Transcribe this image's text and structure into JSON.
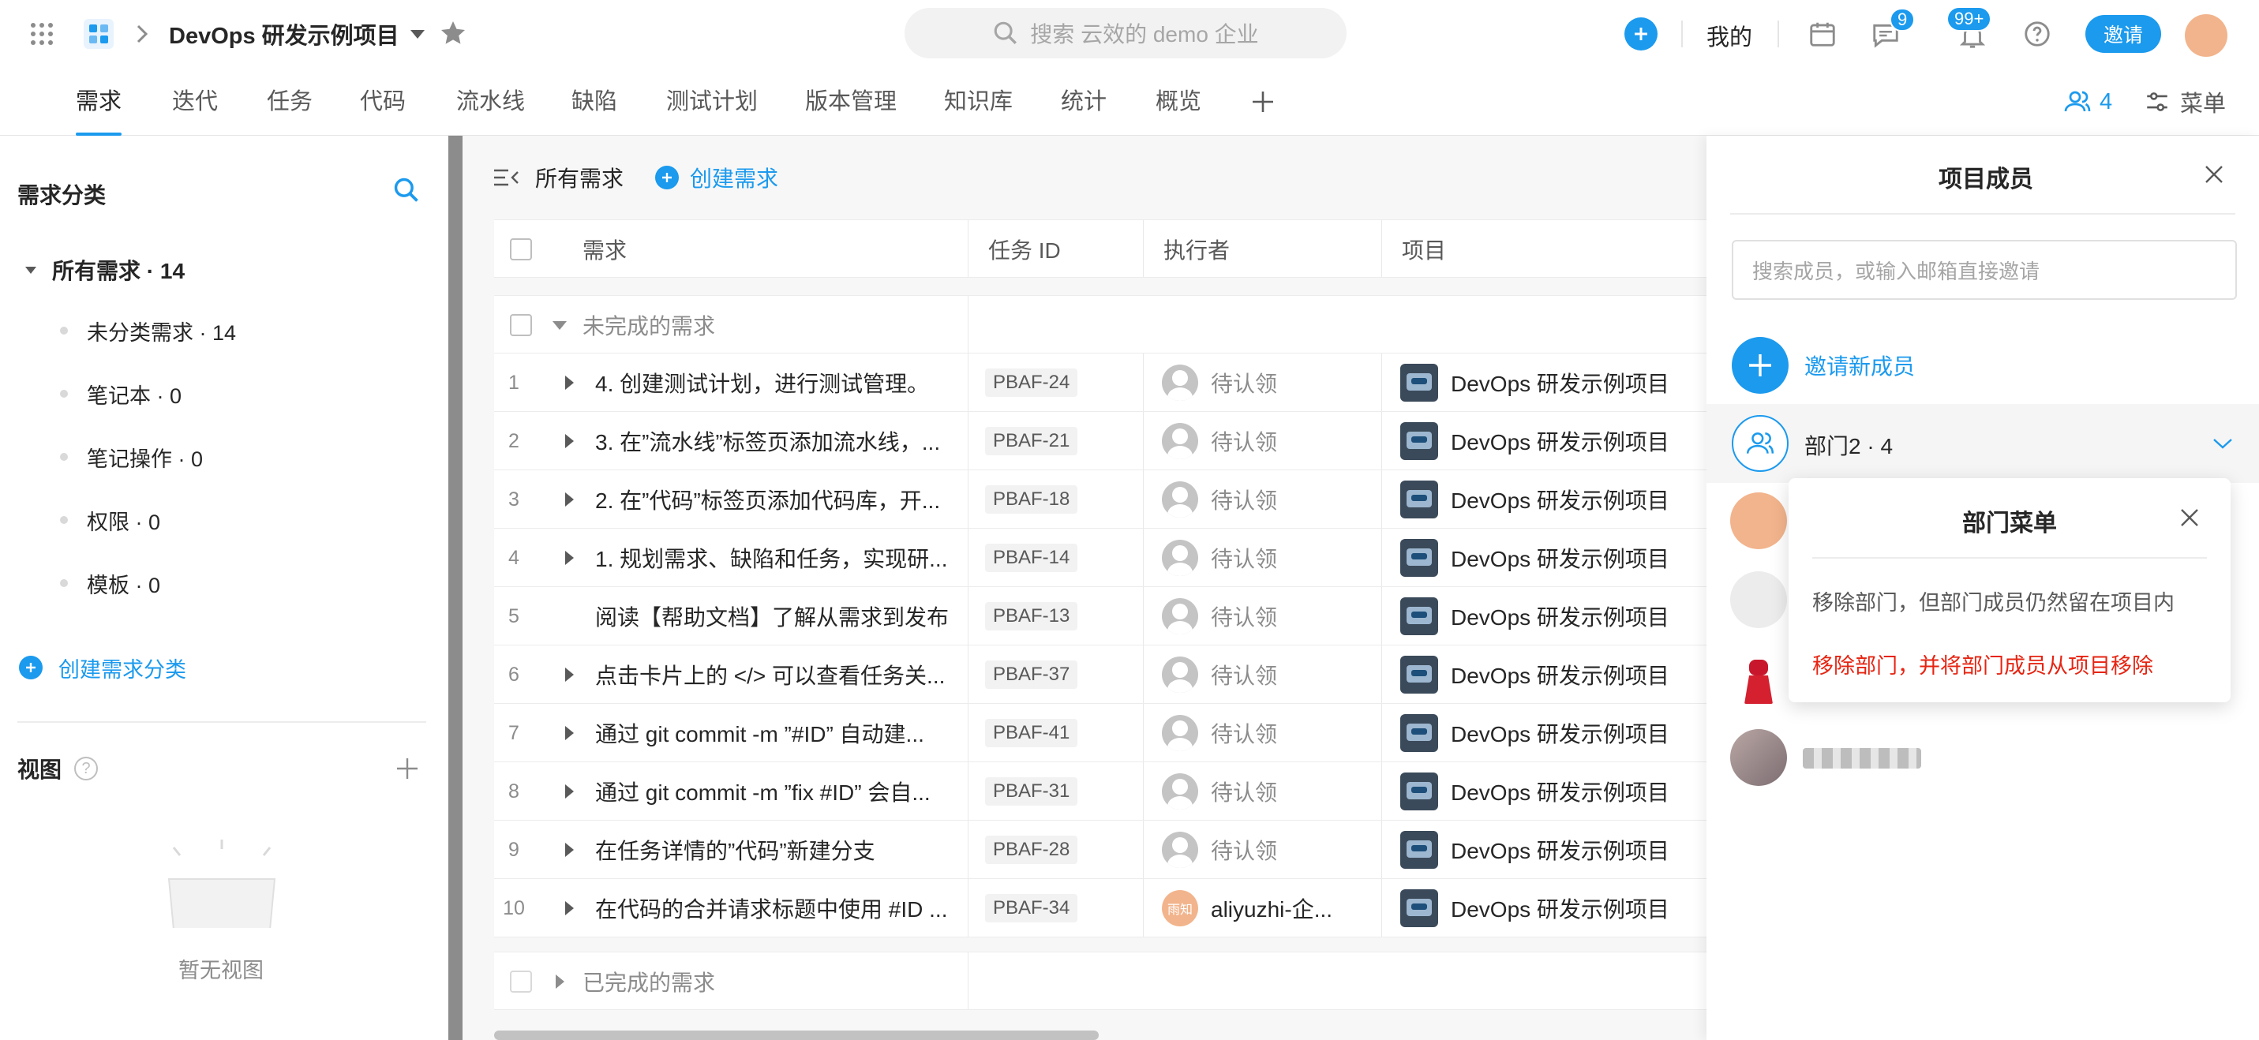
{
  "topbar": {
    "project_title": "DevOps 研发示例项目",
    "search_placeholder": "搜索 云效的 demo 企业",
    "mine_label": "我的",
    "messages_badge": "9",
    "notifications_badge": "99+",
    "invite_label": "邀请",
    "accent_color": "#1b9aee"
  },
  "tabs": [
    "需求",
    "迭代",
    "任务",
    "代码",
    "流水线",
    "缺陷",
    "测试计划",
    "版本管理",
    "知识库",
    "统计",
    "概览"
  ],
  "tabs_right": {
    "members_count": "4",
    "menu_label": "菜单"
  },
  "sidebar": {
    "title": "需求分类",
    "root": "所有需求 · 14",
    "items": [
      "未分类需求 · 14",
      "笔记本 · 0",
      "笔记操作 · 0",
      "权限 · 0",
      "模板 · 0"
    ],
    "create_label": "创建需求分类",
    "views_title": "视图",
    "empty_text": "暂无视图"
  },
  "main": {
    "filter_label": "所有需求",
    "create_label": "创建需求",
    "columns": [
      "需求",
      "任务 ID",
      "执行者",
      "项目"
    ],
    "group_open": "未完成的需求",
    "group_done": "已完成的需求",
    "rows": [
      {
        "num": "1",
        "title": "4. 创建测试计划，进行测试管理。",
        "id": "PBAF-24",
        "assignee": "待认领",
        "project": "DevOps 研发示例项目",
        "expandable": true
      },
      {
        "num": "2",
        "title": "3. 在”流水线”标签页添加流水线，...",
        "id": "PBAF-21",
        "assignee": "待认领",
        "project": "DevOps 研发示例项目",
        "expandable": true
      },
      {
        "num": "3",
        "title": "2. 在”代码”标签页添加代码库，开...",
        "id": "PBAF-18",
        "assignee": "待认领",
        "project": "DevOps 研发示例项目",
        "expandable": true
      },
      {
        "num": "4",
        "title": "1. 规划需求、缺陷和任务，实现研...",
        "id": "PBAF-14",
        "assignee": "待认领",
        "project": "DevOps 研发示例项目",
        "expandable": true
      },
      {
        "num": "5",
        "title": "阅读【帮助文档】了解从需求到发布",
        "id": "PBAF-13",
        "assignee": "待认领",
        "project": "DevOps 研发示例项目",
        "expandable": false
      },
      {
        "num": "6",
        "title": "点击卡片上的 </> 可以查看任务关...",
        "id": "PBAF-37",
        "assignee": "待认领",
        "project": "DevOps 研发示例项目",
        "expandable": true
      },
      {
        "num": "7",
        "title": "通过 git commit -m ”#ID” 自动建...",
        "id": "PBAF-41",
        "assignee": "待认领",
        "project": "DevOps 研发示例项目",
        "expandable": true
      },
      {
        "num": "8",
        "title": "通过 git commit -m ”fix #ID” 会自...",
        "id": "PBAF-31",
        "assignee": "待认领",
        "project": "DevOps 研发示例项目",
        "expandable": true
      },
      {
        "num": "9",
        "title": "在任务详情的”代码”新建分支",
        "id": "PBAF-28",
        "assignee": "待认领",
        "project": "DevOps 研发示例项目",
        "expandable": true
      },
      {
        "num": "10",
        "title": "在代码的合并请求标题中使用 #ID ...",
        "id": "PBAF-34",
        "assignee": "aliyuzhi-企...",
        "assignee_avatar_text": "雨知",
        "project": "DevOps 研发示例项目",
        "expandable": true
      }
    ]
  },
  "panel": {
    "title": "项目成员",
    "search_placeholder": "搜索成员，或输入邮箱直接邀请",
    "invite_label": "邀请新成员",
    "dept_label": "部门2 · 4"
  },
  "popover": {
    "title": "部门菜单",
    "option_keep": "移除部门，但部门成员仍然留在项目内",
    "option_remove": "移除部门，并将部门成员从项目移除",
    "danger_color": "#e62412"
  }
}
